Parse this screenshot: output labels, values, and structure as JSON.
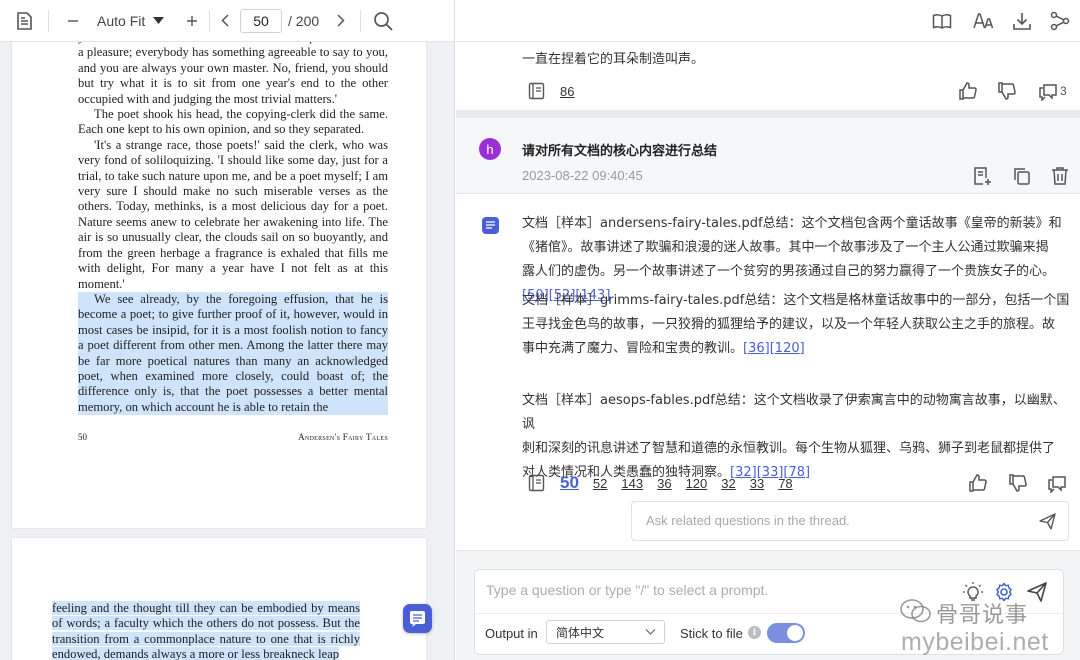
{
  "pdf_viewer": {
    "zoom": "Auto Fit",
    "current_page": "50",
    "total_pages": "/ 200",
    "page_footer": {
      "number": "50",
      "title": "Andersen's Fairy Tales"
    },
    "page1_paragraphs": [
      {
        "text": "you are the better off. To sit at one's ease and poetise—that is a pleasure; everybody has something agreeable to say to you, and you are always your own master. No, friend, you should but try what it is to sit from one year's end to the other occupied with and judging the most trivial matters.'",
        "indent": false,
        "highlight": false
      },
      {
        "text": "The poet shook his head, the copying-clerk did the same. Each one kept to his own opinion, and so they separated.",
        "indent": true,
        "highlight": false
      },
      {
        "text": "'It's a strange race, those poets!' said the clerk, who was very fond of soliloquizing. 'I should like some day, just for a trial, to take such nature upon me, and be a poet myself; I am very sure I should make no such miserable verses as the others. Today, methinks, is a most delicious day for a poet. Nature seems anew to celebrate her awakening into life. The air is so unusually clear, the clouds sail on so buoyantly, and from the green herbage a fragrance is exhaled that fills me with delight, For many a year have I not felt as at this moment.'",
        "indent": true,
        "highlight": false
      },
      {
        "text": "We see already, by the foregoing effusion, that he is become a poet; to give further proof of it, however, would in most cases be insipid, for it is a most foolish notion to fancy a poet different from other men. Among the latter there may be far more poetical natures than many an acknowledged poet, when examined more closely, could boast of; the difference only is, that the poet possesses a better mental memory, on which account he is able to retain the",
        "indent": true,
        "highlight": true
      }
    ],
    "page2_text": "feeling and the thought till they can be embodied by means of words; a faculty which the others do not possess. But the transition from a commonplace nature to one that is richly endowed, demands always a more or less breakneck leap"
  },
  "chat": {
    "prev_answer_tail": "一直在捏着它的耳朵制造叫声。",
    "prev_refs": [
      "86"
    ],
    "prev_comment_count": "3",
    "question": {
      "avatar": "h",
      "text": "请对所有文档的核心内容进行总结",
      "time": "2023-08-22 09:40:45"
    },
    "answer": [
      {
        "lines": [
          "文档［样本］andersens-fairy-tales.pdf总结：这个文档包含两个童话故事《皇帝的新装》和",
          "《猪倌》。故事讲述了欺骗和浪漫的迷人故事。其中一个故事涉及了一个主人公通过欺骗来揭",
          "露人们的虚伪。另一个故事讲述了一个贫穷的男孩通过自己的努力赢得了一个贵族女子的心。"
        ],
        "cites": [
          "50",
          "52",
          "143"
        ],
        "cite_on_new_line": true
      },
      {
        "lines": [
          "文档［样本］grimms-fairy-tales.pdf总结：这个文档是格林童话故事中的一部分，包括一个国",
          "王寻找金色鸟的故事，一只狡猾的狐狸给予的建议，以及一个年轻人获取公主之手的旅程。故",
          "事中充满了魔力、冒险和宝贵的教训。"
        ],
        "cites": [
          "36",
          "120"
        ],
        "cite_on_new_line": false
      },
      {
        "lines": [
          "文档［样本］aesops-fables.pdf总结：这个文档收录了伊索寓言中的动物寓言故事，以幽默、讽",
          "刺和深刻的讯息讲述了智慧和道德的永恒教训。每个生物从狐狸、乌鸦、狮子到老鼠都提供了",
          "对人类情况和人类愚蠢的独特洞察。"
        ],
        "cites": [
          "32",
          "33",
          "78"
        ],
        "cite_on_new_line": false
      }
    ],
    "answer_refs": [
      "50",
      "52",
      "143",
      "36",
      "120",
      "32",
      "33",
      "78"
    ],
    "active_ref": "50",
    "thread_placeholder": "Ask related questions in the thread.",
    "prompt_placeholder": "Type a question or type \"/\" to select a prompt.",
    "output_label": "Output in",
    "output_language": "简体中文",
    "stick_label": "Stick to file",
    "stick_enabled": true
  },
  "watermark": {
    "name": "骨哥说事",
    "url": "mybeibei.net"
  },
  "colors": {
    "accent": "#4a5fd6",
    "avatar": "#9b2fd6",
    "highlight": "#cfe3fa",
    "toggle": "#7a8fe0"
  }
}
